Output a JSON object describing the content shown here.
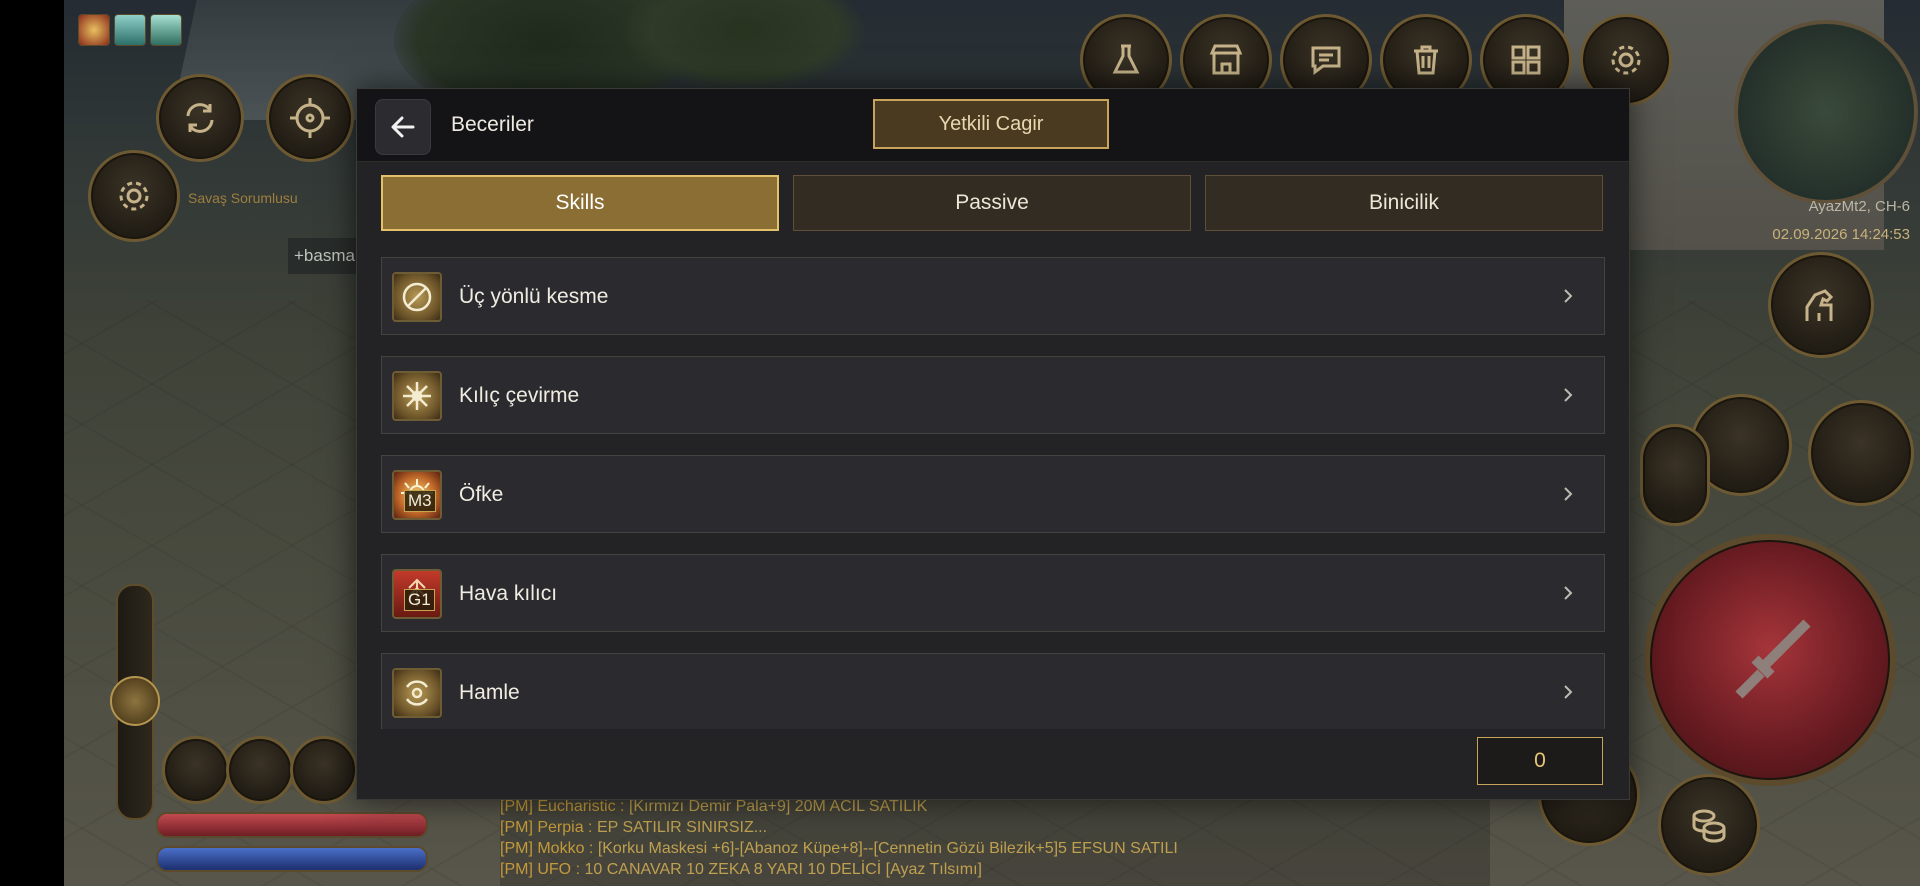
{
  "world": {
    "side_label": "Savaş Sorumlusu",
    "plus_input": "+basma",
    "server_channel": "AyazMt2, CH-6",
    "clock": "02.09.2026 14:24:53"
  },
  "chat": [
    {
      "tag": "[PM]",
      "from": "Eucharistic :",
      "text": "[Kırmızı Demir Pala+9] 20M ACİL SATILIK"
    },
    {
      "tag": "[PM]",
      "from": "Perpia :",
      "text": "EP   SATILIR   SINIRSIZ..."
    },
    {
      "tag": "[PM]",
      "from": "Mokko :",
      "text": "[Korku Maskesi +6]-[Abanoz Küpe+8]--[Cennetin Gözü Bilezik+5]5 EFSUN SATILI"
    },
    {
      "tag": "[PM]",
      "from": "UFO :",
      "text": "10 CANAVAR 10 ZEKA 8 YARI 10 DELİCİ [Ayaz Tılsımı]"
    }
  ],
  "panel": {
    "title": "Beceriler",
    "gm_button": "Yetkili Cagir",
    "tabs": [
      "Skills",
      "Passive",
      "Binicilik"
    ],
    "active_tab": "Skills",
    "skills": [
      {
        "name": "Üç yönlü kesme",
        "badge": "",
        "icon": "slash-circle-icon"
      },
      {
        "name": "Kılıç çevirme",
        "badge": "",
        "icon": "spinning-blade-icon"
      },
      {
        "name": "Öfke",
        "badge": "M3",
        "icon": "rage-burst-icon"
      },
      {
        "name": "Hava kılıcı",
        "badge": "G1",
        "icon": "air-sword-icon"
      },
      {
        "name": "Hamle",
        "badge": "",
        "icon": "charge-swirl-icon"
      }
    ],
    "points": "0"
  },
  "colors": {
    "accent_gold": "#e3c06a",
    "tab_active": "#8a6e33",
    "panel_bg": "#232326",
    "header_bg": "#141417"
  }
}
